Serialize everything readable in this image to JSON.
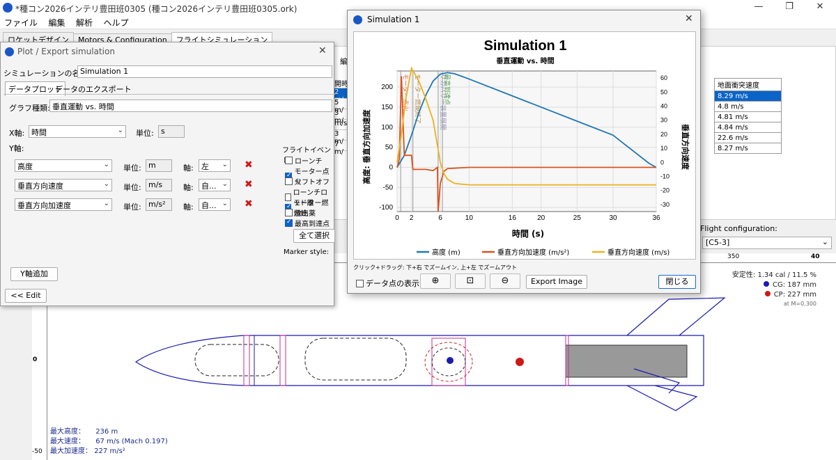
{
  "main_window": {
    "title": "*種コン2026インテリ豊田班0305 (種コン2026インテリ豊田班0305.ork)",
    "menu": [
      "ファイル",
      "編集",
      "解析",
      "ヘルプ"
    ],
    "tabs": [
      "ロケットデザイン",
      "Motors & Configuration",
      "フライトシミュレーション"
    ],
    "minimize": "—",
    "maximize": "❐",
    "close": "✕"
  },
  "results_table": {
    "left_fragments": [
      "開時",
      "2 m/",
      "5 m/",
      "3 m/",
      "m/s",
      "3 m/",
      "7 m/"
    ],
    "header": "地面衝突速度",
    "rows": [
      "8.29 m/s",
      "4.8 m/s",
      "4.81 m/s",
      "4.84 m/s",
      "22.6 m/s",
      "8.27 m/s"
    ],
    "cut_header": "編"
  },
  "flight_configuration": {
    "label": "Flight configuration:",
    "value": "[C5-3]"
  },
  "design_view": {
    "ruler_top": [
      "350",
      "40"
    ],
    "ruler_left": [
      "0",
      "-50"
    ],
    "stability": "安定性: 1.34 cal / 11.5 %",
    "cg": "CG: 187 mm",
    "cp": "CP: 227 mm",
    "mach": "at M=0.300",
    "stats": [
      {
        "label": "最大高度：",
        "value": "236 m"
      },
      {
        "label": "最大速度：",
        "value": "67 m/s  (Mach 0.197)"
      },
      {
        "label": "最大加速度：",
        "value": "227 m/s²"
      }
    ]
  },
  "plot_dialog": {
    "title": "Plot / Export simulation",
    "sim_name_label": "シミュレーションの名前:",
    "sim_name": "Simulation 1",
    "tabs": [
      "データプロット",
      "データのエクスポート"
    ],
    "graph_type_label": "グラフ種類:",
    "graph_type": "垂直運動 vs. 時間",
    "x_axis_label": "X軸:",
    "x_axis_value": "時間",
    "unit_label": "単位:",
    "x_unit": "s",
    "y_axis_label": "Y軸:",
    "axis_label": "軸:",
    "y_rows": [
      {
        "name": "高度",
        "unit": "m",
        "axis": "左"
      },
      {
        "name": "垂直方向速度",
        "unit": "m/s",
        "axis": "自..."
      },
      {
        "name": "垂直方向加速度",
        "unit": "m/s²",
        "axis": "自..."
      }
    ],
    "unit_prefix": "単位:",
    "events_label": "フライトイベント:",
    "events": [
      {
        "label": "ローンチ",
        "checked": false
      },
      {
        "label": "モーター点火",
        "checked": true
      },
      {
        "label": "リフトオフ",
        "checked": false
      },
      {
        "label": "ローンチロッド離",
        "checked": false
      },
      {
        "label": "モーター燃焼終",
        "checked": true
      },
      {
        "label": "放出薬",
        "checked": false
      },
      {
        "label": "最高到達点",
        "checked": true
      }
    ],
    "select_all": "全て選択",
    "marker_style": "Marker style:",
    "add_y_axis": "Y軸追加",
    "edit_button": "<< Edit",
    "close": "✕"
  },
  "sim_dialog": {
    "title": "Simulation 1",
    "hint": "クリック+ドラッグ: 下+右 でズームイン, 上+左 でズームアウト",
    "show_points": "データ点の表示",
    "export": "Export Image",
    "close_button": "閉じる",
    "close": "✕"
  },
  "chart_data": {
    "type": "line",
    "title": "Simulation 1",
    "subtitle": "垂直運動 vs. 時間",
    "xlabel": "時間 (s)",
    "ylabel_left": "高度: 垂直方向加速度",
    "ylabel_right": "垂直方向速度",
    "xlim": [
      0,
      36
    ],
    "ylim_left": [
      -110,
      240
    ],
    "ylim_right": [
      -35,
      65
    ],
    "xticks": [
      0,
      2,
      6,
      10,
      16,
      20,
      25,
      30,
      36
    ],
    "yticks_left": [
      200,
      150,
      100,
      50,
      0,
      -50,
      -100
    ],
    "yticks_right": [
      60,
      50,
      40,
      30,
      20,
      10,
      0,
      -10,
      -20,
      -30
    ],
    "legend_position": "bottom",
    "series": [
      {
        "name": "高度 (m)",
        "color": "#1f77b4",
        "axis": "left",
        "x": [
          0,
          1,
          2,
          3,
          4,
          5,
          6,
          7,
          8,
          10,
          15,
          20,
          25,
          30,
          35,
          36
        ],
        "y": [
          0,
          30,
          80,
          135,
          180,
          215,
          232,
          236,
          233,
          220,
          185,
          150,
          115,
          80,
          10,
          0
        ]
      },
      {
        "name": "垂直方向加速度 (m/s²)",
        "color": "#d9531e",
        "axis": "left",
        "x": [
          0,
          0.3,
          0.6,
          1.0,
          2.0,
          2.2,
          4.0,
          5.0,
          5.6,
          5.7,
          6.0,
          6.5,
          7.0,
          10,
          20,
          36
        ],
        "y": [
          0,
          20,
          227,
          30,
          30,
          -5,
          -5,
          -8,
          0,
          -110,
          -40,
          -10,
          -3,
          0,
          0,
          0
        ]
      },
      {
        "name": "垂直方向速度 (m/s)",
        "color": "#edb120",
        "axis": "right",
        "x": [
          0,
          0.6,
          1.2,
          2.0,
          3.0,
          4.0,
          5.0,
          5.5,
          6.0,
          6.5,
          7.0,
          8.0,
          10,
          20,
          36
        ],
        "y": [
          0,
          20,
          45,
          67,
          58,
          45,
          30,
          15,
          0,
          -8,
          -12,
          -15,
          -16,
          -16,
          -16
        ]
      }
    ],
    "events": [
      {
        "x": 0.5,
        "label": "モーター点火"
      },
      {
        "x": 2.2,
        "label": "モーター燃焼終了"
      },
      {
        "x": 5.7,
        "label": "リカバリー装置展開"
      },
      {
        "x": 6.3,
        "label": "最高到達点"
      }
    ]
  }
}
